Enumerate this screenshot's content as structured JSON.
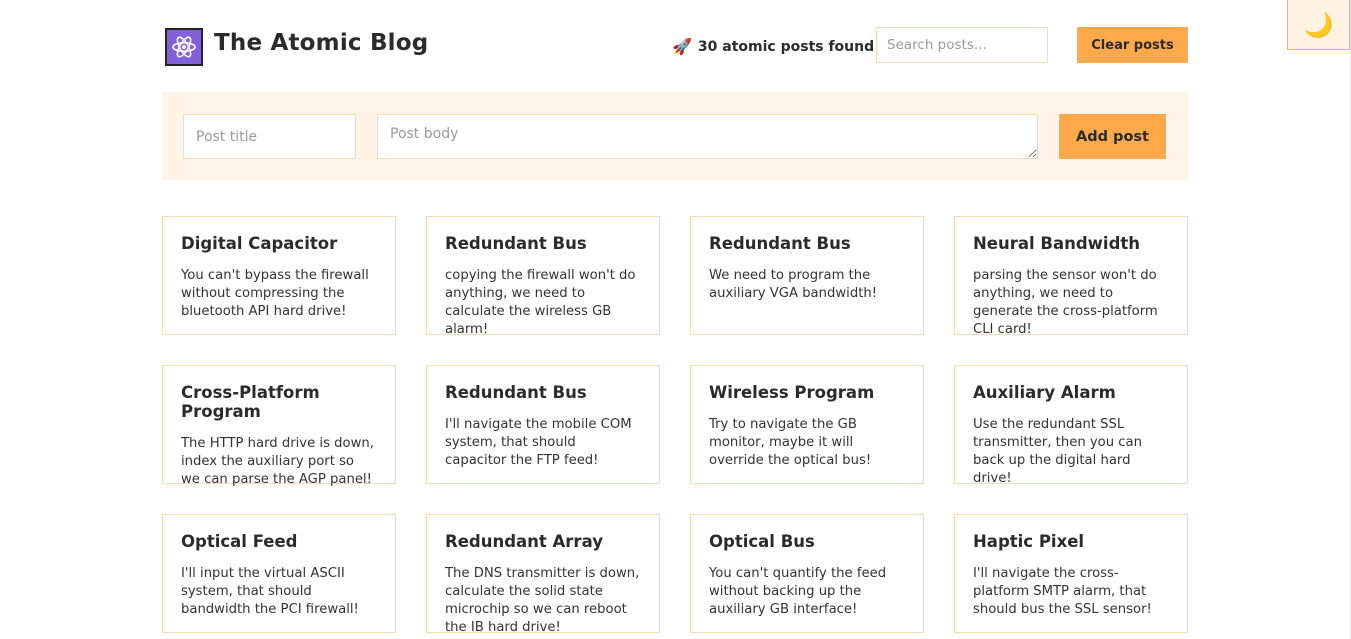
{
  "header": {
    "title": "The Atomic Blog",
    "posts_found": "30 atomic posts found",
    "search_placeholder": "Search posts...",
    "clear_label": "Clear posts",
    "dark_mode_icon": "🌙",
    "logo_icon": "atom-icon",
    "rocket_icon": "🚀"
  },
  "form": {
    "title_placeholder": "Post title",
    "body_placeholder": "Post body",
    "add_label": "Add post"
  },
  "colors": {
    "accent": "#ffa94a",
    "form_bg": "#fff4e6",
    "border": "#f6dcb5",
    "logo_bg": "#8160d9"
  },
  "posts": [
    {
      "title": "Digital Capacitor",
      "body": "You can't bypass the firewall without compressing the bluetooth API hard drive!"
    },
    {
      "title": "Redundant Bus",
      "body": "copying the firewall won't do anything, we need to calculate the wireless GB alarm!"
    },
    {
      "title": "Redundant Bus",
      "body": "We need to program the auxiliary VGA bandwidth!"
    },
    {
      "title": "Neural Bandwidth",
      "body": "parsing the sensor won't do anything, we need to generate the cross-platform CLI card!"
    },
    {
      "title": "Cross-Platform Program",
      "body": "The HTTP hard drive is down, index the auxiliary port so we can parse the AGP panel!"
    },
    {
      "title": "Redundant Bus",
      "body": "I'll navigate the mobile COM system, that should capacitor the FTP feed!"
    },
    {
      "title": "Wireless Program",
      "body": "Try to navigate the GB monitor, maybe it will override the optical bus!"
    },
    {
      "title": "Auxiliary Alarm",
      "body": "Use the redundant SSL transmitter, then you can back up the digital hard drive!"
    },
    {
      "title": "Optical Feed",
      "body": "I'll input the virtual ASCII system, that should bandwidth the PCI firewall!"
    },
    {
      "title": "Redundant Array",
      "body": "The DNS transmitter is down, calculate the solid state microchip so we can reboot the IB hard drive!"
    },
    {
      "title": "Optical Bus",
      "body": "You can't quantify the feed without backing up the auxiliary GB interface!"
    },
    {
      "title": "Haptic Pixel",
      "body": "I'll navigate the cross-platform SMTP alarm, that should bus the SSL sensor!"
    }
  ]
}
